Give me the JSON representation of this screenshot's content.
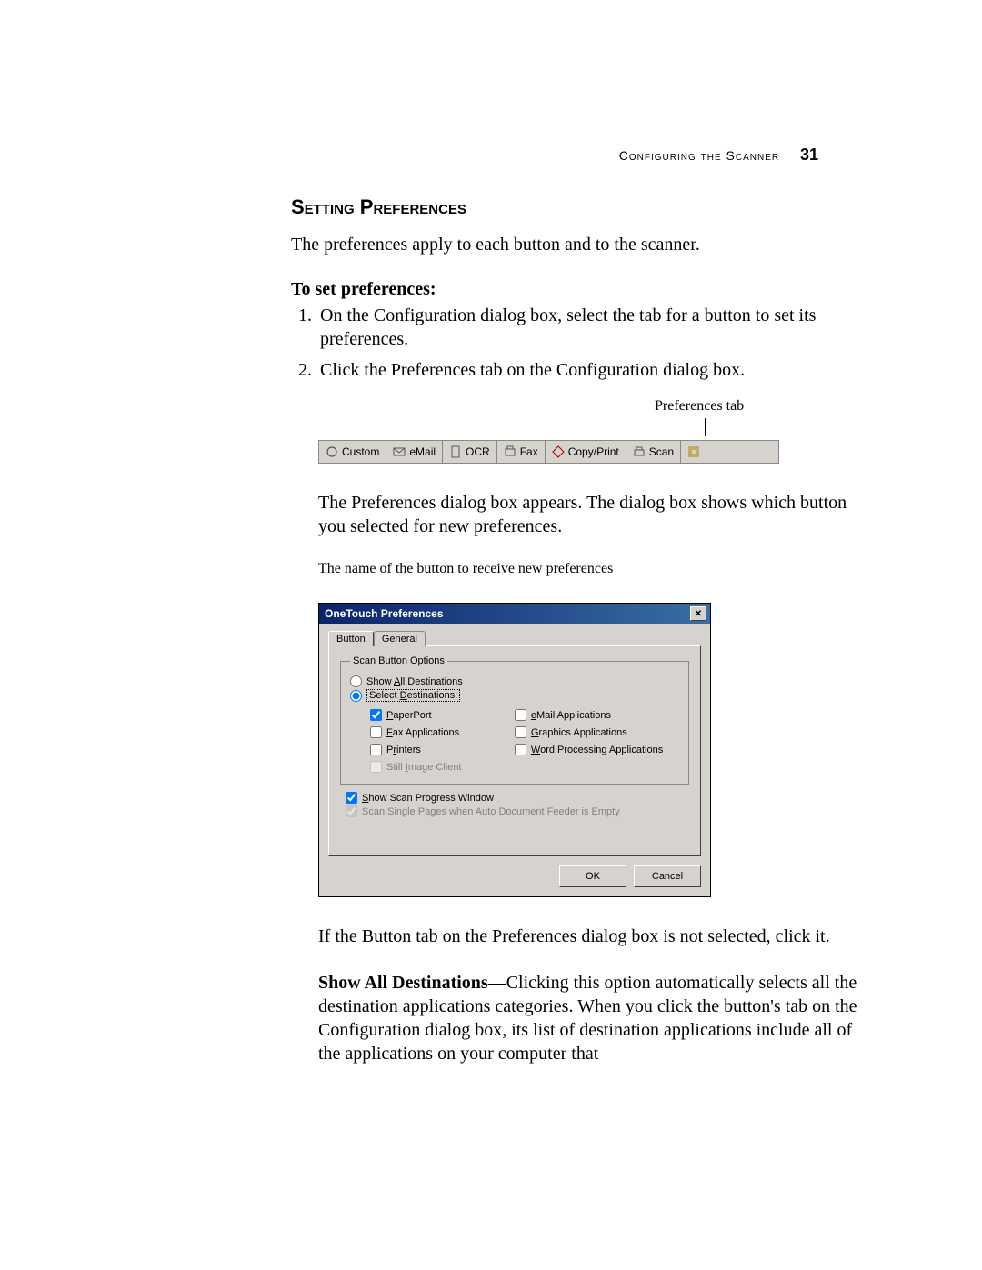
{
  "header": {
    "running_head": "Configuring the Scanner",
    "page_number": "31"
  },
  "section_title": "Setting Preferences",
  "intro": "The preferences apply to each button and to the scanner.",
  "subhead": "To set preferences:",
  "steps": [
    "On the Configuration dialog box, select the tab for a button to set its preferences.",
    "Click the Preferences tab on the Configuration dialog box."
  ],
  "annot_tabstrip": "Preferences tab",
  "tabstrip": {
    "custom": "Custom",
    "email": "eMail",
    "ocr": "OCR",
    "fax": "Fax",
    "copyprint": "Copy/Print",
    "scan": "Scan"
  },
  "para_after_tabstrip": "The Preferences dialog box appears. The dialog box shows which button you selected for new preferences.",
  "annot_dialog": "The name of the button to receive new preferences",
  "dialog": {
    "title": "OneTouch Preferences",
    "tab_button": "Button",
    "tab_general": "General",
    "group_label": "Scan Button Options",
    "radio_show_all": "Show All Destinations",
    "radio_select": "Select Destinations:",
    "dest_paperport": "PaperPort",
    "dest_email": "eMail Applications",
    "dest_fax": "Fax Applications",
    "dest_graphics": "Graphics Applications",
    "dest_printers": "Printers",
    "dest_word": "Word Processing Applications",
    "dest_still": "Still Image Client",
    "chk_progress": "Show Scan Progress Window",
    "chk_single": "Scan Single Pages when Auto Document Feeder is Empty",
    "btn_ok": "OK",
    "btn_cancel": "Cancel"
  },
  "para_after_dialog": "If the Button tab on the Preferences dialog box is not selected, click it.",
  "show_all_label": "Show All Destinations",
  "show_all_text": "—Clicking this option automatically selects all the destination applications categories. When you click the button's tab on the Configuration dialog box, its list of destination applications include all of the applications on your computer that"
}
